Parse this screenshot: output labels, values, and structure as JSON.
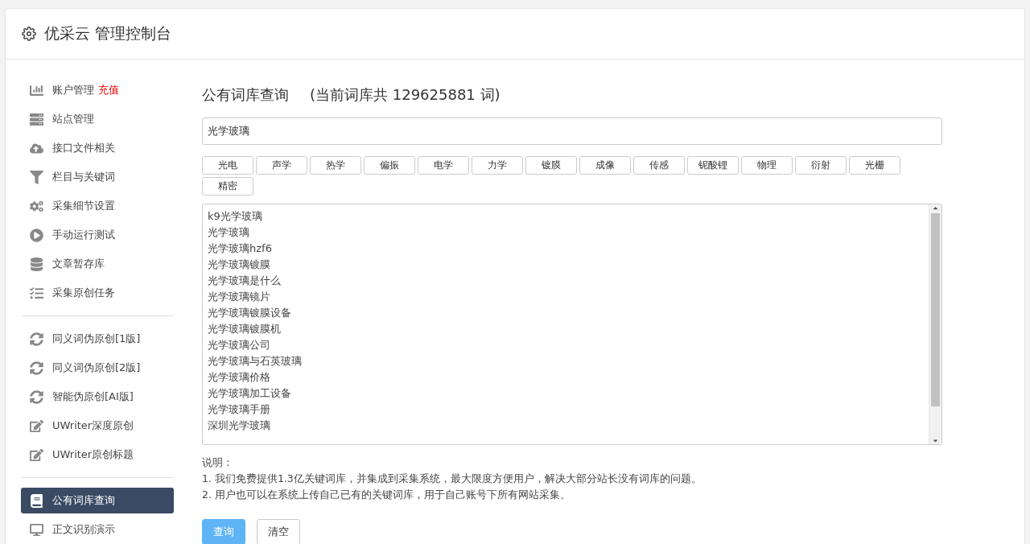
{
  "header": {
    "title": "优采云 管理控制台"
  },
  "sidebar": {
    "groups": [
      {
        "items": [
          {
            "label": "账户管理",
            "badge": "充值",
            "kind": "chart",
            "selected": false
          },
          {
            "label": "站点管理",
            "kind": "server",
            "selected": false
          },
          {
            "label": "接口文件相关",
            "kind": "cloud",
            "selected": false
          },
          {
            "label": "栏目与关键词",
            "kind": "filter",
            "selected": false
          },
          {
            "label": "采集细节设置",
            "kind": "cogs",
            "selected": false
          },
          {
            "label": "手动运行测试",
            "kind": "play",
            "selected": false
          },
          {
            "label": "文章暂存库",
            "kind": "database",
            "selected": false
          },
          {
            "label": "采集原创任务",
            "kind": "tasks",
            "selected": false
          }
        ]
      },
      {
        "items": [
          {
            "label": "同义词伪原创[1版]",
            "kind": "sync",
            "selected": false
          },
          {
            "label": "同义词伪原创[2版]",
            "kind": "sync",
            "selected": false
          },
          {
            "label": "智能伪原创[AI版]",
            "kind": "sync",
            "selected": false
          },
          {
            "label": "UWriter深度原创",
            "kind": "edit",
            "selected": false
          },
          {
            "label": "UWriter原创标题",
            "kind": "edit",
            "selected": false
          }
        ]
      },
      {
        "items": [
          {
            "label": "公有词库查询",
            "kind": "book",
            "selected": true
          },
          {
            "label": "正文识别演示",
            "kind": "desktop",
            "selected": false
          }
        ]
      }
    ]
  },
  "main": {
    "title": "公有词库查询",
    "subtitle": "(当前词库共 129625881 词)",
    "search": {
      "value": "光学玻璃"
    },
    "tags": [
      "光电",
      "声学",
      "热学",
      "偏振",
      "电学",
      "力学",
      "镀膜",
      "成像",
      "传感",
      "铌酸锂",
      "物理",
      "衍射",
      "光栅",
      "精密"
    ],
    "results": [
      "k9光学玻璃",
      "光学玻璃",
      "光学玻璃hzf6",
      "光学玻璃镀膜",
      "光学玻璃是什么",
      "光学玻璃镜片",
      "光学玻璃镀膜设备",
      "光学玻璃镀膜机",
      "光学玻璃公司",
      "光学玻璃与石英玻璃",
      "光学玻璃价格",
      "光学玻璃加工设备",
      "光学玻璃手册",
      "深圳光学玻璃"
    ],
    "notes": [
      "说明：",
      "1. 我们免费提供1.3亿关键词库，并集成到采集系统，最大限度方便用户，解决大部分站长没有词库的问题。",
      "2. 用户也可以在系统上传自己已有的关键词库，用于自己账号下所有网站采集。"
    ],
    "buttons": [
      {
        "label": "查询",
        "kind": "primary"
      },
      {
        "label": "清空",
        "kind": "default"
      }
    ]
  }
}
